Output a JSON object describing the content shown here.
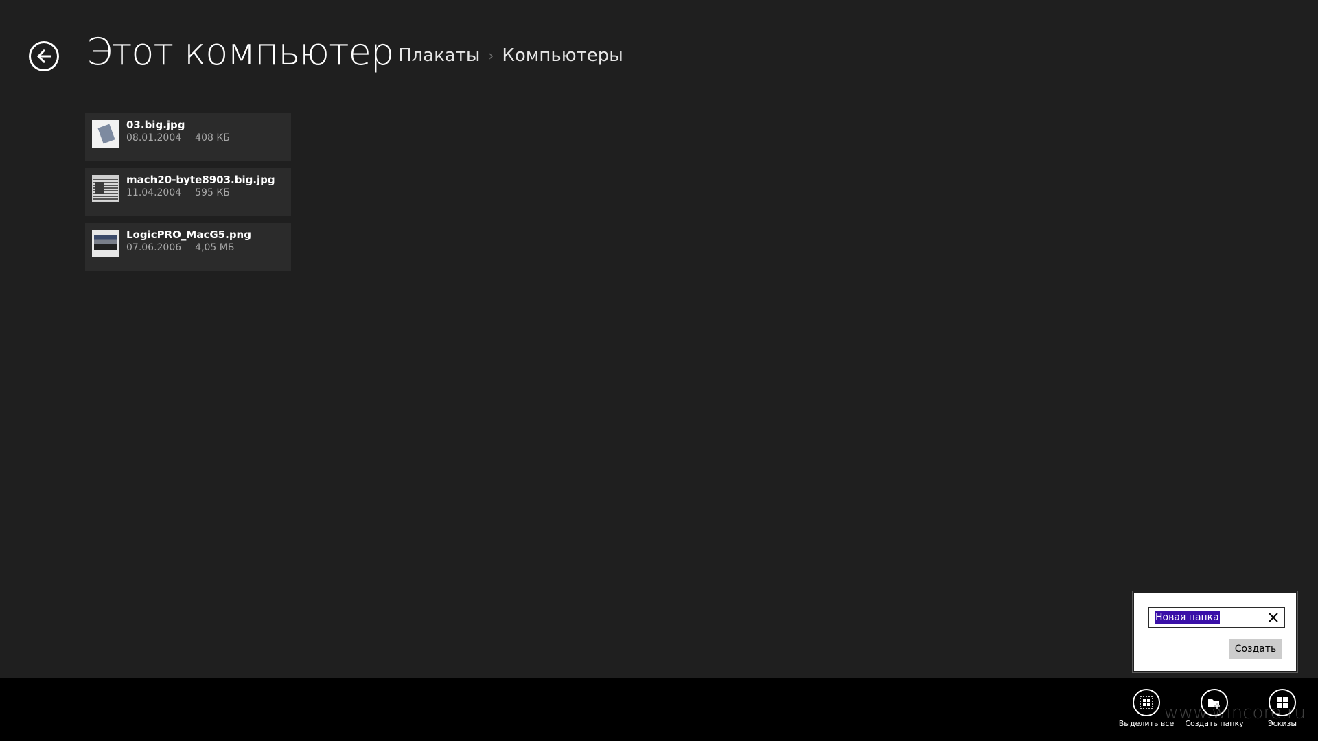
{
  "header": {
    "title": "Этот компьютер",
    "breadcrumb": [
      "Плакаты",
      "Компьютеры"
    ]
  },
  "files": [
    {
      "name": "03.big.jpg",
      "date": "08.01.2004",
      "size": "408 КБ"
    },
    {
      "name": "mach20-byte8903.big.jpg",
      "date": "11.04.2004",
      "size": "595 КБ"
    },
    {
      "name": "LogicPRO_MacG5.png",
      "date": "07.06.2006",
      "size": "4,05 МБ"
    }
  ],
  "new_folder_flyout": {
    "input_value": "Новая папка",
    "create_label": "Создать"
  },
  "app_bar": {
    "select_all_label": "Выделить все",
    "new_folder_label": "Создать папку",
    "thumbnails_label": "Эскизы"
  },
  "watermark": "www.wincore.ru",
  "icons": {
    "back": "back-arrow-icon",
    "clear": "close-icon",
    "select_all": "select-all-icon",
    "new_folder": "new-folder-icon",
    "thumbnails": "thumbnails-grid-icon"
  },
  "colors": {
    "background": "#1f1f1f",
    "tile": "#2b2b2b",
    "app_bar": "#000000",
    "selection": "#3a10a8"
  }
}
